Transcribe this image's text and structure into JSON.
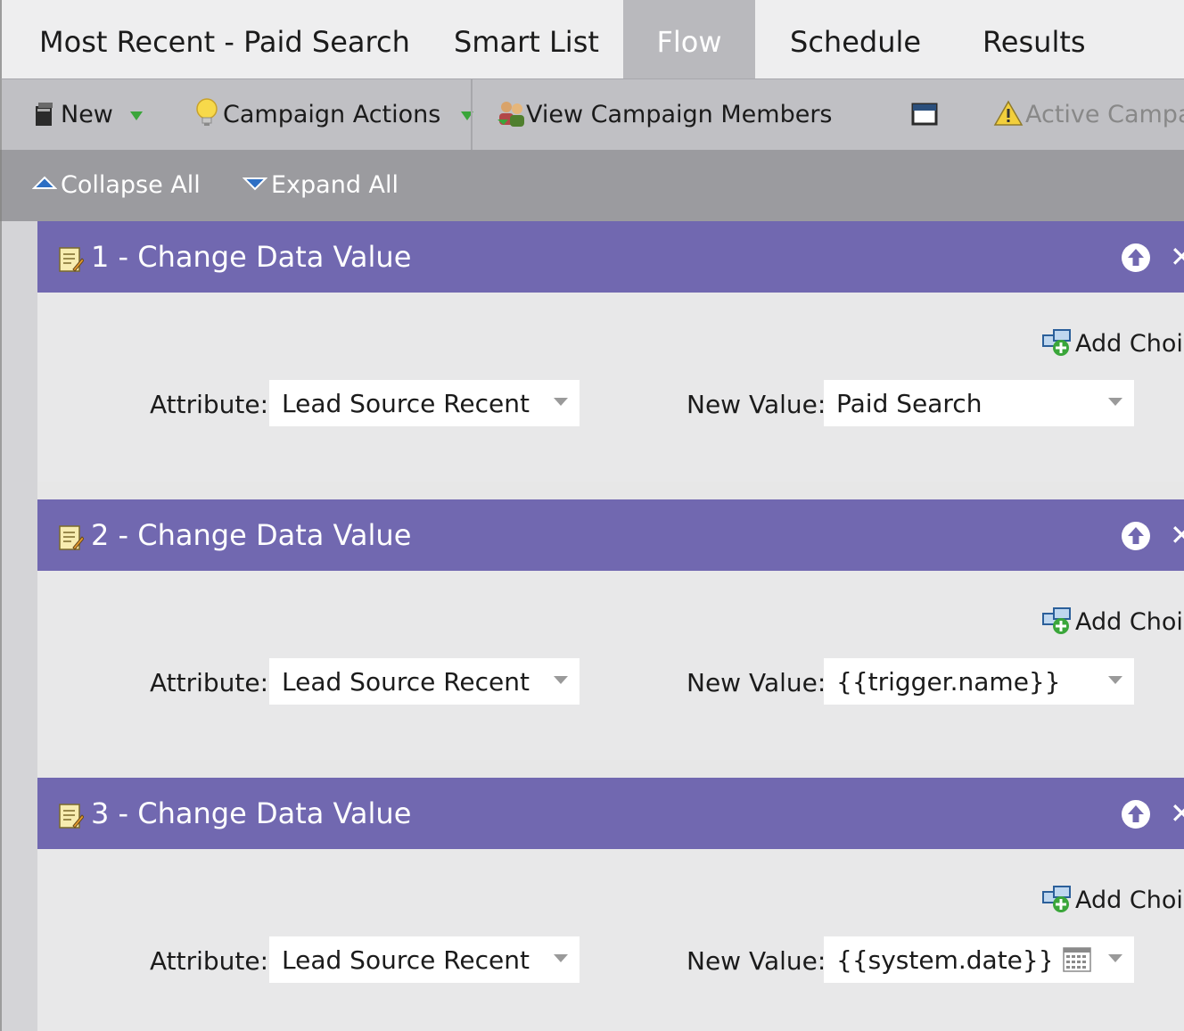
{
  "tabs": [
    {
      "label": "Most Recent - Paid Search",
      "active": false
    },
    {
      "label": "Smart List",
      "active": false
    },
    {
      "label": "Flow",
      "active": true
    },
    {
      "label": "Schedule",
      "active": false
    },
    {
      "label": "Results",
      "active": false
    }
  ],
  "toolbar": {
    "new_label": "New",
    "campaign_actions_label": "Campaign Actions",
    "view_members_label": "View Campaign Members",
    "active_campaign_label": "Active Campaig"
  },
  "subbar": {
    "collapse_label": "Collapse All",
    "expand_label": "Expand All"
  },
  "steps": [
    {
      "title": "1 - Change Data Value",
      "add_choice_label": "Add Choic",
      "attribute_label": "Attribute:",
      "attribute_value": "Lead Source Recent",
      "new_value_label": "New Value:",
      "new_value": "Paid Search",
      "has_calendar": false
    },
    {
      "title": "2 - Change Data Value",
      "add_choice_label": "Add Choic",
      "attribute_label": "Attribute:",
      "attribute_value": "Lead Source Recent D",
      "new_value_label": "New Value:",
      "new_value": "{{trigger.name}}",
      "has_calendar": false
    },
    {
      "title": "3 - Change Data Value",
      "add_choice_label": "Add Choic",
      "attribute_label": "Attribute:",
      "attribute_value": "Lead Source Recent Da",
      "new_value_label": "New Value:",
      "new_value": "{{system.date}}",
      "has_calendar": true
    }
  ],
  "colors": {
    "step_header": "#7168b0",
    "active_tab": "#b9b9bd",
    "toolbar": "#c0c0c4",
    "subbar": "#9b9b9f"
  },
  "icons": {
    "new": "document-stack-icon",
    "campaign_actions": "lightbulb-icon",
    "view_members": "people-icon",
    "window": "window-icon",
    "warning": "warning-icon",
    "collapse": "triangle-up-icon",
    "expand": "triangle-down-icon",
    "step": "notepad-pencil-icon",
    "move_up": "arrow-up-circle-icon",
    "delete": "close-icon",
    "add_choice": "add-choice-icon",
    "calendar": "calendar-grid-icon"
  }
}
